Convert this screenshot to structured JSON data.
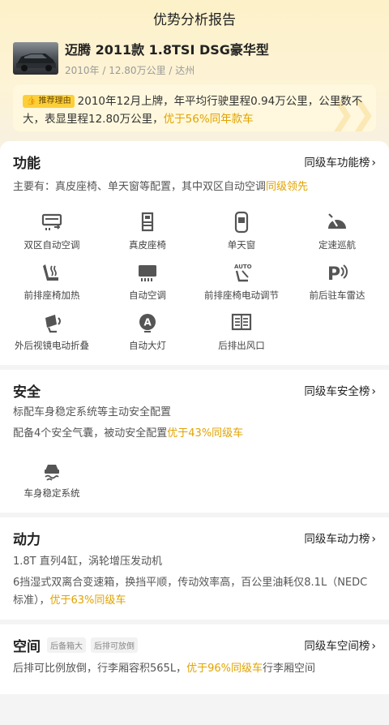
{
  "header": {
    "title": "优势分析报告"
  },
  "car": {
    "name": "迈腾 2011款 1.8TSI DSG豪华型",
    "meta": "2010年 / 12.80万公里 / 达州"
  },
  "reason": {
    "badge": "推荐理由",
    "text": "2010年12月上牌，年平均行驶里程0.94万公里，公里数不大，表显里程12.80万公里，",
    "highlight": "优于56%同年款车"
  },
  "functions": {
    "title": "功能",
    "link": "同级车功能榜",
    "summary": "主要有：真皮座椅、单天窗等配置，其中双区自动空调",
    "summary_highlight": "同级领先",
    "features": [
      {
        "label": "双区自动空调",
        "icon": "dual-zone-ac-icon"
      },
      {
        "label": "真皮座椅",
        "icon": "leather-seat-icon"
      },
      {
        "label": "单天窗",
        "icon": "sunroof-icon"
      },
      {
        "label": "定速巡航",
        "icon": "cruise-control-icon"
      },
      {
        "label": "前排座椅加热",
        "icon": "seat-heating-icon"
      },
      {
        "label": "自动空调",
        "icon": "auto-ac-icon"
      },
      {
        "label": "前排座椅电动调节",
        "icon": "power-seat-icon"
      },
      {
        "label": "前后驻车雷达",
        "icon": "parking-radar-icon"
      },
      {
        "label": "外后视镜电动折叠",
        "icon": "mirror-fold-icon"
      },
      {
        "label": "自动大灯",
        "icon": "auto-headlight-icon"
      },
      {
        "label": "后排出风口",
        "icon": "rear-vent-icon"
      }
    ]
  },
  "safety": {
    "title": "安全",
    "link": "同级车安全榜",
    "line1": "标配车身稳定系统等主动安全配置",
    "line2": "配备4个安全气囊，被动安全配置",
    "line2_highlight": "优于43%同级车",
    "features": [
      {
        "label": "车身稳定系统",
        "icon": "stability-control-icon"
      }
    ]
  },
  "power": {
    "title": "动力",
    "link": "同级车动力榜",
    "line1": "1.8T 直列4缸，涡轮增压发动机",
    "line2": "6挡湿式双离合变速箱，换挡平顺，传动效率高，百公里油耗仅8.1L（NEDC标准），",
    "line2_highlight": "优于63%同级车"
  },
  "space": {
    "title": "空间",
    "tags": [
      "后备箱大",
      "后排可放倒"
    ],
    "link": "同级车空间榜",
    "line1": "后排可比例放倒，行李厢容积565L，",
    "line1_highlight": "优于96%同级车",
    "line1_tail": "行李厢空间"
  },
  "colors": {
    "accent": "#e1a300",
    "badge": "#fccf3a"
  }
}
